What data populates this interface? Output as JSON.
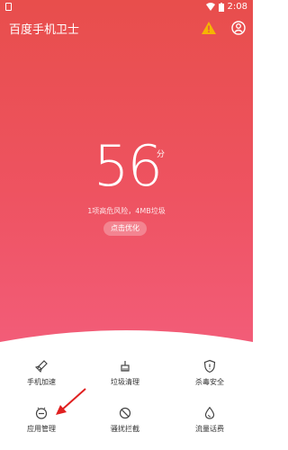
{
  "status_bar": {
    "time": "2:08"
  },
  "header": {
    "title": "百度手机卫士"
  },
  "score": {
    "value": "56",
    "unit": "分",
    "risk_text": "1项高危风险，4MB垃圾",
    "optimize_label": "点击优化"
  },
  "colors": {
    "gradient_top": "#e84e4c",
    "gradient_bottom": "#f35d7a",
    "warning": "#f5b400"
  },
  "tools": [
    {
      "label": "手机加速",
      "icon": "rocket-icon"
    },
    {
      "label": "垃圾清理",
      "icon": "broom-icon"
    },
    {
      "label": "杀毒安全",
      "icon": "shield-icon"
    },
    {
      "label": "应用管理",
      "icon": "app-manager-icon"
    },
    {
      "label": "骚扰拦截",
      "icon": "block-icon"
    },
    {
      "label": "流量话费",
      "icon": "data-drop-icon"
    }
  ]
}
